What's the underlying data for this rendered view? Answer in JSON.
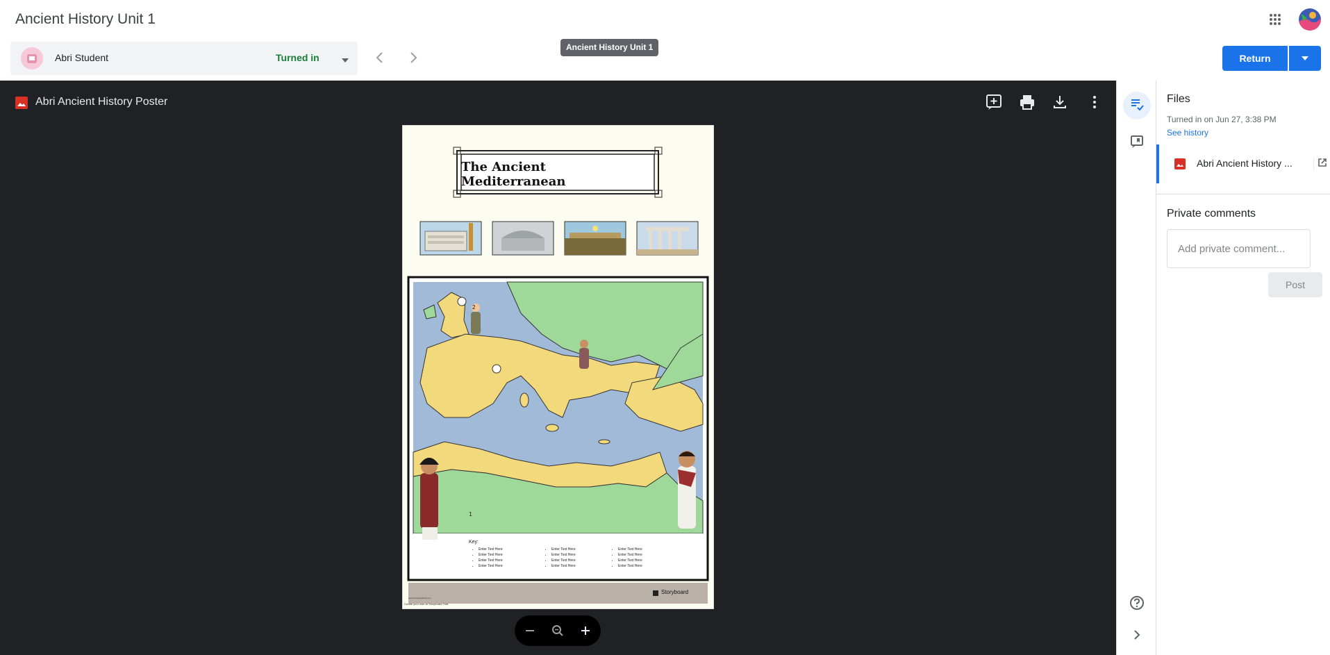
{
  "app": {
    "title": "Ancient History Unit 1"
  },
  "student": {
    "name": "Abri Student",
    "status": "Turned in"
  },
  "tooltip": "Ancient History Unit 1",
  "actions": {
    "return_label": "Return"
  },
  "viewer": {
    "file_name": "Abri Ancient History Poster",
    "tools": [
      "add-comment-icon",
      "print-icon",
      "download-icon",
      "more-vert-icon"
    ],
    "poster": {
      "title": "The Ancient Mediterranean",
      "key_label": "Key:",
      "columns": [
        [
          "Enter Text Here",
          "Enter Text Here",
          "Enter Text Here",
          "Enter Text Here"
        ],
        [
          "Enter Text Here",
          "Enter Text Here",
          "Enter Text Here",
          "Enter Text Here"
        ],
        [
          "Enter Text Here",
          "Enter Text Here",
          "Enter Text Here",
          "Enter Text Here"
        ]
      ],
      "brand": "Storyboard",
      "footer": "Create your own at Storyboard That",
      "url": "www.storyboardthat.com",
      "markers": [
        "1",
        "2"
      ]
    }
  },
  "files_panel": {
    "title": "Files",
    "turned_in": "Turned in on Jun 27, 3:38 PM",
    "see_history": "See history",
    "file_name": "Abri Ancient History ..."
  },
  "comments": {
    "title": "Private comments",
    "placeholder": "Add private comment...",
    "post_label": "Post"
  },
  "colors": {
    "accent": "#1a73e8",
    "status": "#188038",
    "viewer_bg": "#202124",
    "file_red": "#d93025"
  }
}
